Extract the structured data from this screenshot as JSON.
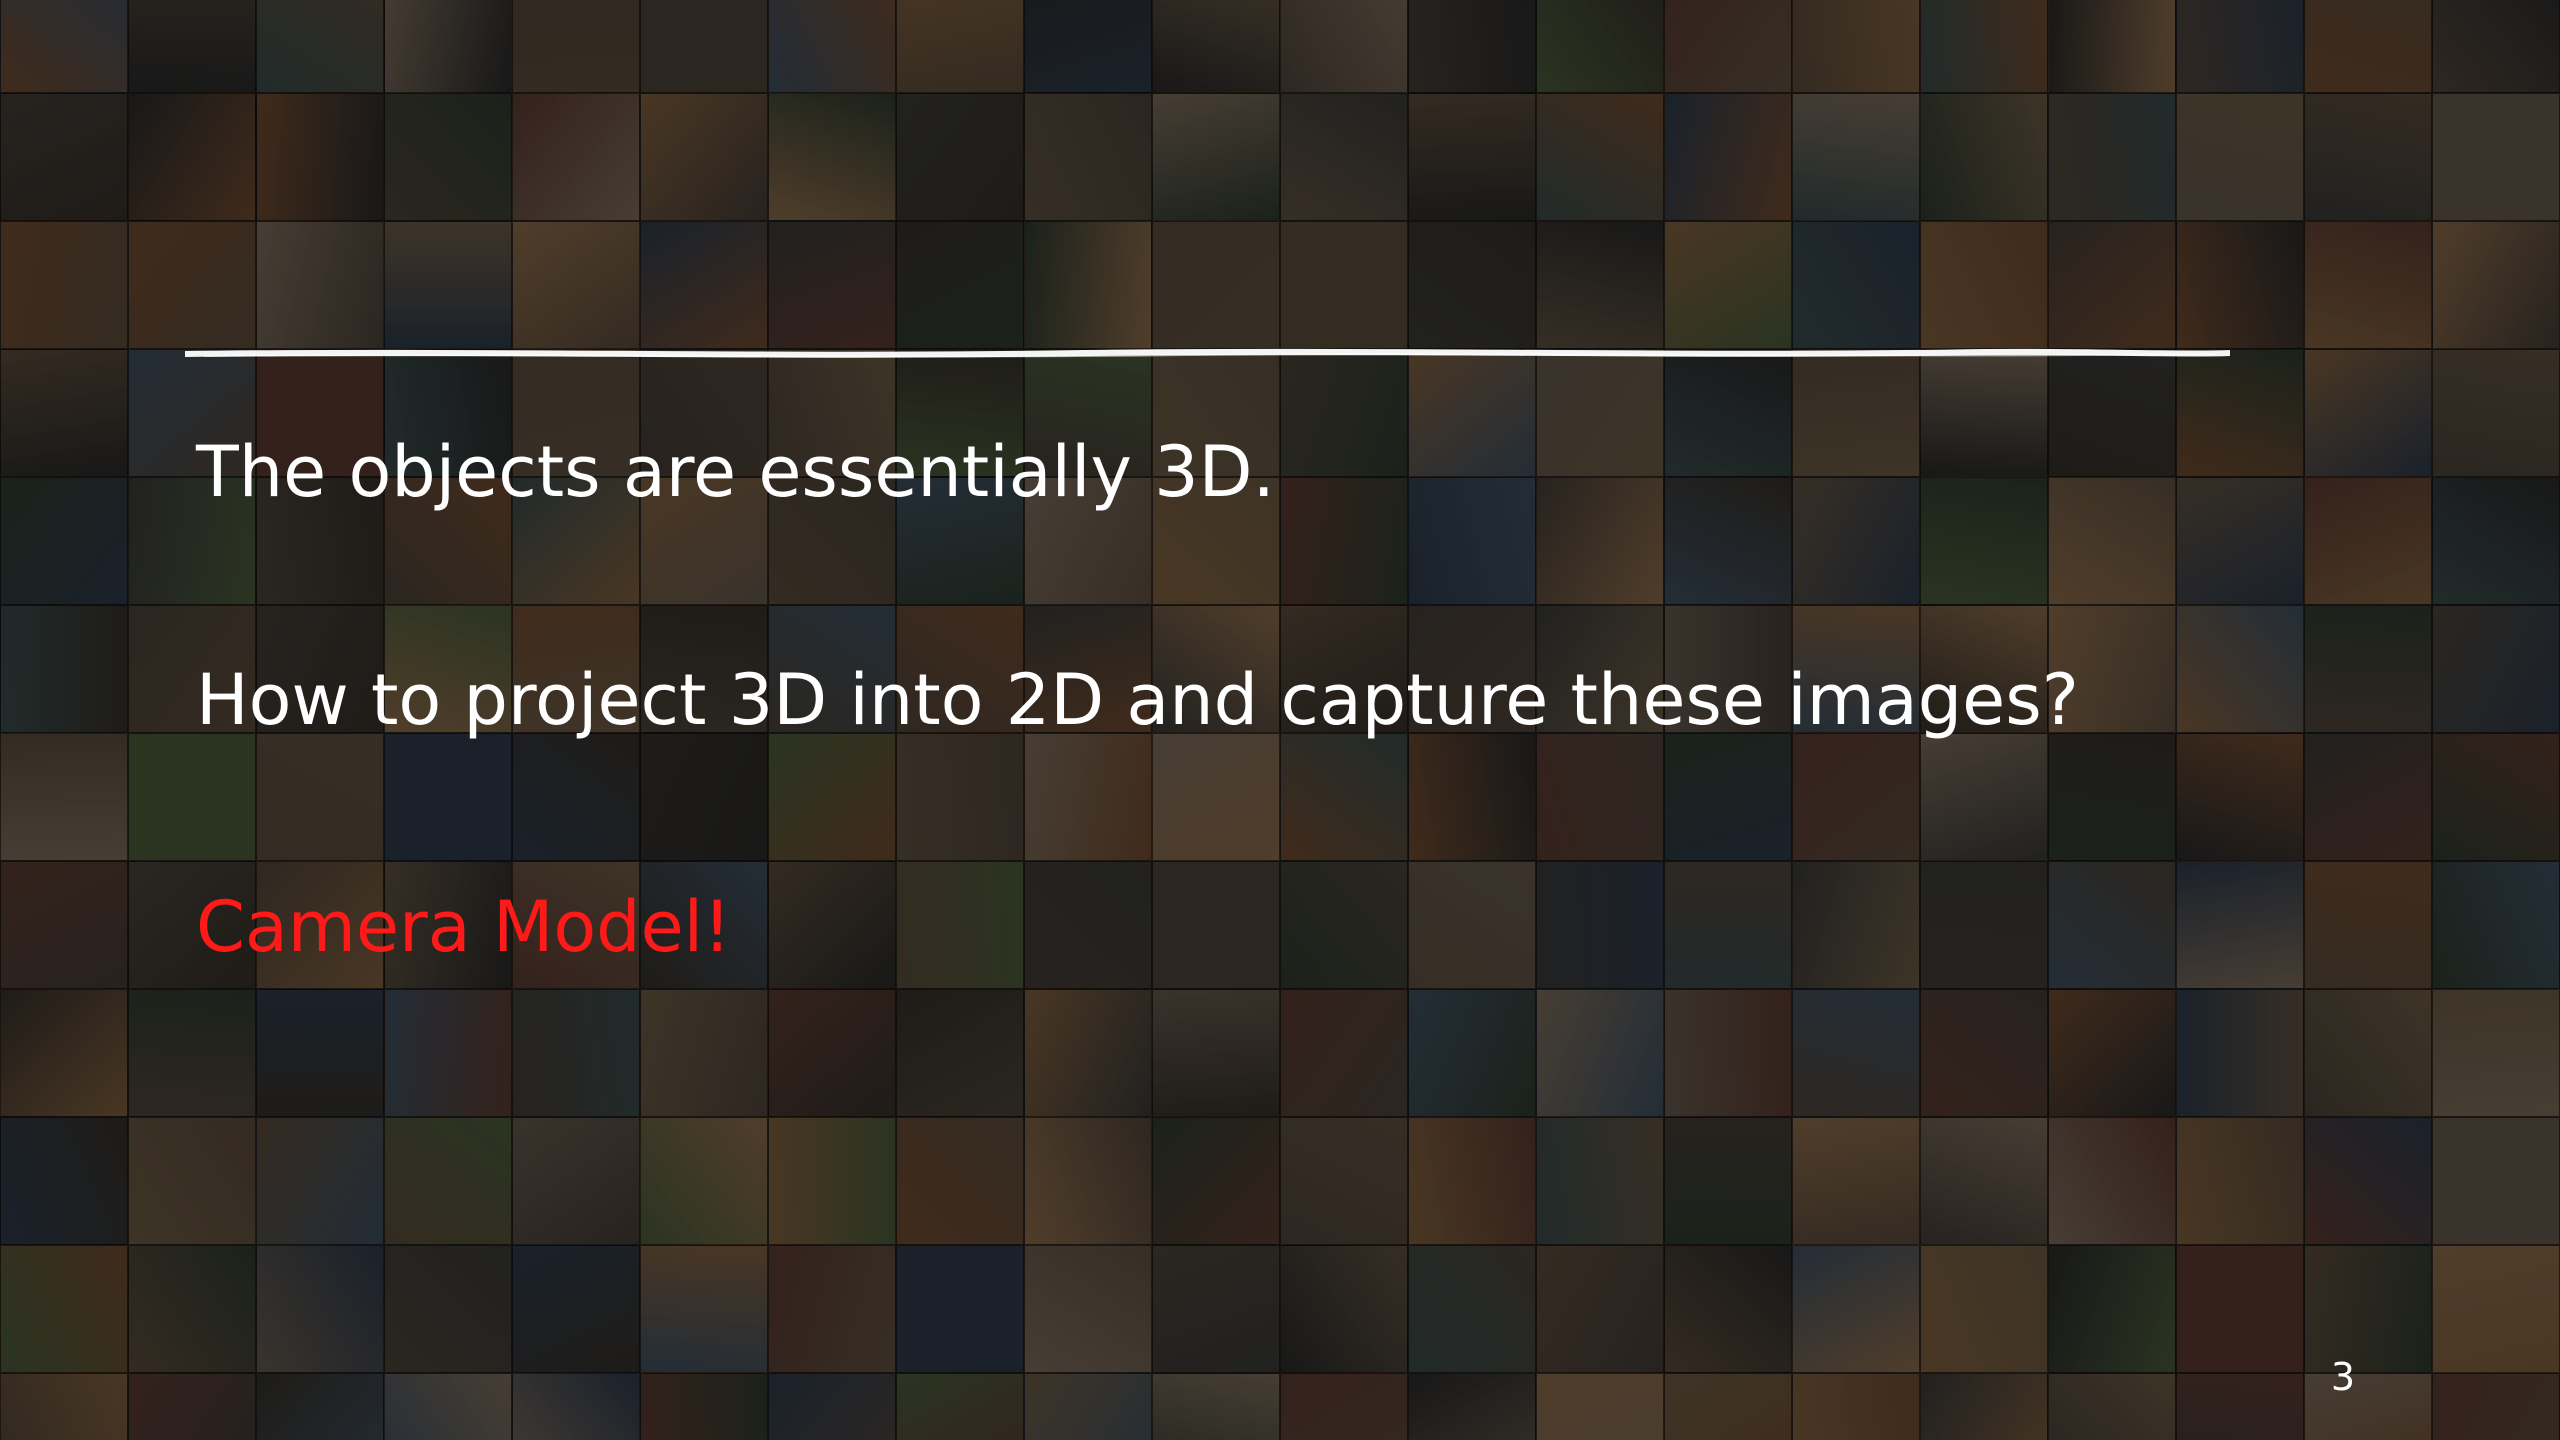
{
  "slide": {
    "line1": "The objects are essentially 3D.",
    "line2": "How to project 3D into 2D and capture these images?",
    "line3": "Camera Model!",
    "page_number": "3"
  },
  "colors": {
    "background": "#0d0d0d",
    "text": "#ffffff",
    "highlight": "#ff1a1a",
    "rule": "#ffffff"
  },
  "background_mosaic": {
    "description_icon": "photo-thumbnail-grid",
    "palette": [
      "#3a3a38",
      "#5a4a3a",
      "#2e3a4a",
      "#6a5a44",
      "#4a4238",
      "#7a6a5a",
      "#35302a",
      "#5e5040",
      "#2a2a2a",
      "#6e4a30",
      "#4a5a3a",
      "#3e4e5e",
      "#8a6a4a",
      "#50443a",
      "#2f3b2f",
      "#5a3a30",
      "#64584c",
      "#3a4a4a",
      "#7e5e3e",
      "#443c36"
    ]
  }
}
